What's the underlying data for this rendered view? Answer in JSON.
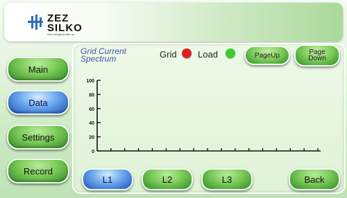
{
  "logo": {
    "line1": "ZEZ",
    "line2": "SILKO",
    "tagline": "Get energized with us"
  },
  "sidebar": {
    "items": [
      {
        "label": "Main"
      },
      {
        "label": "Data",
        "active": true
      },
      {
        "label": "Settings"
      },
      {
        "label": "Record"
      }
    ]
  },
  "header": {
    "title_line1": "Grid Current",
    "title_line2": "Spectrum",
    "legend": [
      {
        "label": "Grid",
        "color": "#e02020"
      },
      {
        "label": "Load",
        "color": "#3ccd2c"
      }
    ],
    "page_up": "PageUp",
    "page_down": "Page\nDown"
  },
  "tabs": [
    {
      "label": "L1",
      "active": true
    },
    {
      "label": "L2"
    },
    {
      "label": "L3"
    }
  ],
  "back_label": "Back",
  "colors": {
    "accent_green": "#7ccb59",
    "accent_blue": "#2f6bd0",
    "title_blue": "#3a59a6"
  },
  "chart_data": {
    "type": "bar",
    "title": "",
    "yticks": [
      "0",
      "20",
      "40",
      "60",
      "80",
      "100"
    ],
    "ylim": [
      0,
      100
    ],
    "x_tick_count": 16,
    "series": []
  }
}
